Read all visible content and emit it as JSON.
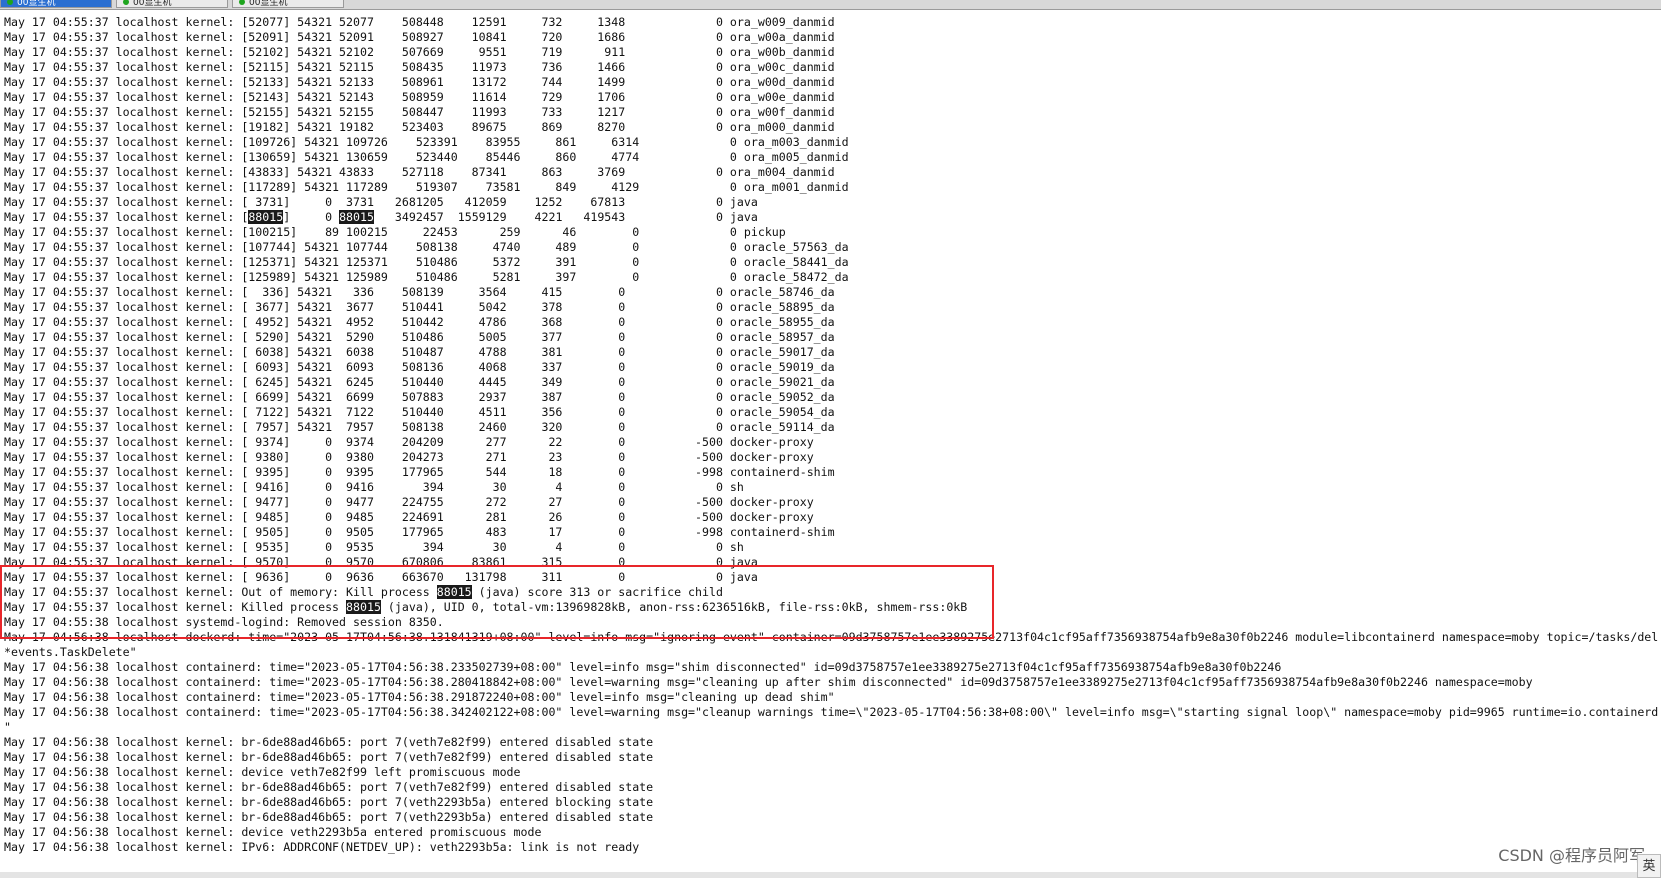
{
  "tabs": [
    {
      "label": "00显生机",
      "active": true
    },
    {
      "label": "00显生机",
      "active": false
    },
    {
      "label": "00显生机",
      "active": false
    }
  ],
  "log_lines": [
    "May 17 04:55:37 localhost kernel: [52077] 54321 52077    508448    12591     732     1348             0 ora_w009_danmid",
    "May 17 04:55:37 localhost kernel: [52091] 54321 52091    508927    10841     720     1686             0 ora_w00a_danmid",
    "May 17 04:55:37 localhost kernel: [52102] 54321 52102    507669     9551     719      911             0 ora_w00b_danmid",
    "May 17 04:55:37 localhost kernel: [52115] 54321 52115    508435    11973     736     1466             0 ora_w00c_danmid",
    "May 17 04:55:37 localhost kernel: [52133] 54321 52133    508961    13172     744     1499             0 ora_w00d_danmid",
    "May 17 04:55:37 localhost kernel: [52143] 54321 52143    508959    11614     729     1706             0 ora_w00e_danmid",
    "May 17 04:55:37 localhost kernel: [52155] 54321 52155    508447    11993     733     1217             0 ora_w00f_danmid",
    "May 17 04:55:37 localhost kernel: [19182] 54321 19182    523403    89675     869     8270             0 ora_m000_danmid",
    "May 17 04:55:37 localhost kernel: [109726] 54321 109726    523391    83955     861     6314             0 ora_m003_danmid",
    "May 17 04:55:37 localhost kernel: [130659] 54321 130659    523440    85446     860     4774             0 ora_m005_danmid",
    "May 17 04:55:37 localhost kernel: [43833] 54321 43833    527118    87341     863     3769             0 ora_m004_danmid",
    "May 17 04:55:37 localhost kernel: [117289] 54321 117289    519307    73581     849     4129             0 ora_m001_danmid",
    "May 17 04:55:37 localhost kernel: [ 3731]     0  3731   2681205   412059    1252    67813             0 java",
    "May 17 04:55:37 localhost kernel: [88015]     0 88015   3492457  1559129    4221   419543             0 java",
    "May 17 04:55:37 localhost kernel: [100215]    89 100215     22453      259      46        0             0 pickup",
    "May 17 04:55:37 localhost kernel: [107744] 54321 107744    508138     4740     489        0             0 oracle_57563_da",
    "May 17 04:55:37 localhost kernel: [125371] 54321 125371    510486     5372     391        0             0 oracle_58441_da",
    "May 17 04:55:37 localhost kernel: [125989] 54321 125989    510486     5281     397        0             0 oracle_58472_da",
    "May 17 04:55:37 localhost kernel: [  336] 54321   336    508139     3564     415        0             0 oracle_58746_da",
    "May 17 04:55:37 localhost kernel: [ 3677] 54321  3677    510441     5042     378        0             0 oracle_58895_da",
    "May 17 04:55:37 localhost kernel: [ 4952] 54321  4952    510442     4786     368        0             0 oracle_58955_da",
    "May 17 04:55:37 localhost kernel: [ 5290] 54321  5290    510486     5005     377        0             0 oracle_58957_da",
    "May 17 04:55:37 localhost kernel: [ 6038] 54321  6038    510487     4788     381        0             0 oracle_59017_da",
    "May 17 04:55:37 localhost kernel: [ 6093] 54321  6093    508136     4068     337        0             0 oracle_59019_da",
    "May 17 04:55:37 localhost kernel: [ 6245] 54321  6245    510440     4445     349        0             0 oracle_59021_da",
    "May 17 04:55:37 localhost kernel: [ 6699] 54321  6699    507883     2937     387        0             0 oracle_59052_da",
    "May 17 04:55:37 localhost kernel: [ 7122] 54321  7122    510440     4511     356        0             0 oracle_59054_da",
    "May 17 04:55:37 localhost kernel: [ 7957] 54321  7957    508138     2460     320        0             0 oracle_59114_da",
    "May 17 04:55:37 localhost kernel: [ 9374]     0  9374    204209      277      22        0          -500 docker-proxy",
    "May 17 04:55:37 localhost kernel: [ 9380]     0  9380    204273      271      23        0          -500 docker-proxy",
    "May 17 04:55:37 localhost kernel: [ 9395]     0  9395    177965      544      18        0          -998 containerd-shim",
    "May 17 04:55:37 localhost kernel: [ 9416]     0  9416       394       30       4        0             0 sh",
    "May 17 04:55:37 localhost kernel: [ 9477]     0  9477    224755      272      27        0          -500 docker-proxy",
    "May 17 04:55:37 localhost kernel: [ 9485]     0  9485    224691      281      26        0          -500 docker-proxy",
    "May 17 04:55:37 localhost kernel: [ 9505]     0  9505    177965      483      17        0          -998 containerd-shim",
    "May 17 04:55:37 localhost kernel: [ 9535]     0  9535       394       30       4        0             0 sh",
    "May 17 04:55:37 localhost kernel: [ 9570]     0  9570    670806    83861     315        0             0 java",
    "May 17 04:55:37 localhost kernel: [ 9636]     0  9636    663670   131798     311        0             0 java",
    "May 17 04:55:37 localhost kernel: Out of memory: Kill process 88015 (java) score 313 or sacrifice child",
    "May 17 04:55:37 localhost kernel: Killed process 88015 (java), UID 0, total-vm:13969828kB, anon-rss:6236516kB, file-rss:0kB, shmem-rss:0kB",
    "May 17 04:55:38 localhost systemd-logind: Removed session 8350.",
    "May 17 04:56:38 localhost dockerd: time=\"2023-05-17T04:56:38.131841319+08:00\" level=info msg=\"ignoring event\" container=09d3758757e1ee3389275e2713f04c1cf95aff7356938754afb9e8a30f0b2246 module=libcontainerd namespace=moby topic=/tasks/del",
    "*events.TaskDelete\"",
    "May 17 04:56:38 localhost containerd: time=\"2023-05-17T04:56:38.233502739+08:00\" level=info msg=\"shim disconnected\" id=09d3758757e1ee3389275e2713f04c1cf95aff7356938754afb9e8a30f0b2246",
    "May 17 04:56:38 localhost containerd: time=\"2023-05-17T04:56:38.280418842+08:00\" level=warning msg=\"cleaning up after shim disconnected\" id=09d3758757e1ee3389275e2713f04c1cf95aff7356938754afb9e8a30f0b2246 namespace=moby",
    "May 17 04:56:38 localhost containerd: time=\"2023-05-17T04:56:38.291872240+08:00\" level=info msg=\"cleaning up dead shim\"",
    "May 17 04:56:38 localhost containerd: time=\"2023-05-17T04:56:38.342402122+08:00\" level=warning msg=\"cleanup warnings time=\\\"2023-05-17T04:56:38+08:00\\\" level=info msg=\\\"starting signal loop\\\" namespace=moby pid=9965 runtime=io.containerd",
    "\"",
    "May 17 04:56:38 localhost kernel: br-6de88ad46b65: port 7(veth7e82f99) entered disabled state",
    "May 17 04:56:38 localhost kernel: br-6de88ad46b65: port 7(veth7e82f99) entered disabled state",
    "May 17 04:56:38 localhost kernel: device veth7e82f99 left promiscuous mode",
    "May 17 04:56:38 localhost kernel: br-6de88ad46b65: port 7(veth7e82f99) entered disabled state",
    "May 17 04:56:38 localhost kernel: br-6de88ad46b65: port 7(veth2293b5a) entered blocking state",
    "May 17 04:56:38 localhost kernel: br-6de88ad46b65: port 7(veth2293b5a) entered disabled state",
    "May 17 04:56:38 localhost kernel: device veth2293b5a entered promiscuous mode",
    "May 17 04:56:38 localhost kernel: IPv6: ADDRCONF(NETDEV_UP): veth2293b5a: link is not ready"
  ],
  "highlight_term": "88015",
  "watermark": "CSDN @程序员阿军",
  "corner_label": "英"
}
